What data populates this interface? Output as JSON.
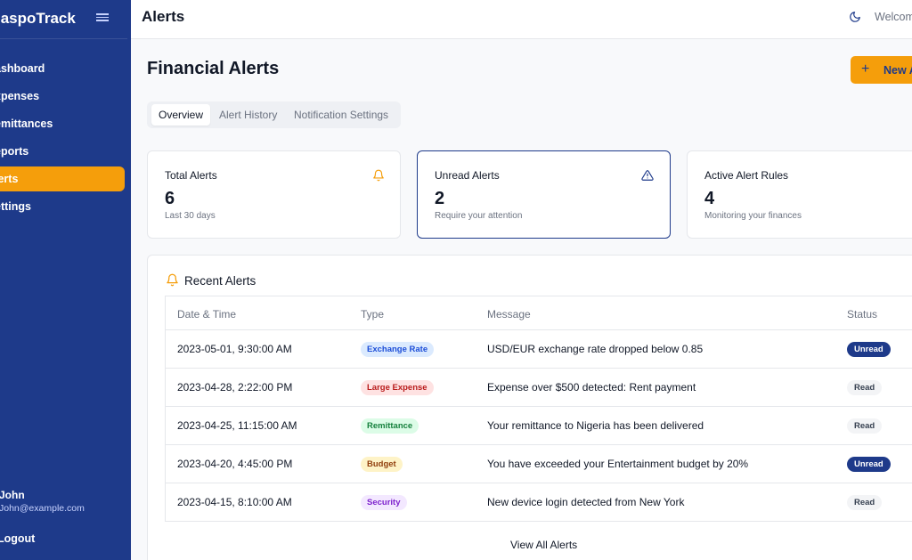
{
  "app": {
    "brand": "iaspoTrack"
  },
  "sidebar": {
    "items": [
      {
        "label": "ashboard",
        "active": false
      },
      {
        "label": "xpenses",
        "active": false
      },
      {
        "label": "emittances",
        "active": false
      },
      {
        "label": "eports",
        "active": false
      },
      {
        "label": "lerts",
        "active": true
      },
      {
        "label": "ettings",
        "active": false
      }
    ],
    "user": {
      "name": "John",
      "email": "John@example.com"
    },
    "logout_label": "Logout"
  },
  "topbar": {
    "title": "Alerts",
    "welcome": "Welcom"
  },
  "main": {
    "title": "Financial Alerts",
    "new_button_label": "New A",
    "tabs": [
      {
        "label": "Overview",
        "active": true
      },
      {
        "label": "Alert History",
        "active": false
      },
      {
        "label": "Notification Settings",
        "active": false
      }
    ],
    "cards": [
      {
        "title": "Total Alerts",
        "value": "6",
        "subtitle": "Last 30 days",
        "icon": "bell-icon"
      },
      {
        "title": "Unread Alerts",
        "value": "2",
        "subtitle": "Require your attention",
        "icon": "warning-triangle-icon"
      },
      {
        "title": "Active Alert Rules",
        "value": "4",
        "subtitle": "Monitoring your finances",
        "icon": ""
      }
    ],
    "recent": {
      "title": "Recent Alerts",
      "columns": [
        "Date & Time",
        "Type",
        "Message",
        "Status"
      ],
      "rows": [
        {
          "datetime": "2023-05-01, 9:30:00 AM",
          "type": "Exchange Rate",
          "message": "USD/EUR exchange rate dropped below 0.85",
          "status": "Unread"
        },
        {
          "datetime": "2023-04-28, 2:22:00 PM",
          "type": "Large Expense",
          "message": "Expense over $500 detected: Rent payment",
          "status": "Read"
        },
        {
          "datetime": "2023-04-25, 11:15:00 AM",
          "type": "Remittance",
          "message": "Your remittance to Nigeria has been delivered",
          "status": "Read"
        },
        {
          "datetime": "2023-04-20, 4:45:00 PM",
          "type": "Budget",
          "message": "You have exceeded your Entertainment budget by 20%",
          "status": "Unread"
        },
        {
          "datetime": "2023-04-15, 8:10:00 AM",
          "type": "Security",
          "message": "New device login detected from New York",
          "status": "Read"
        }
      ],
      "view_all_label": "View All Alerts"
    }
  },
  "colors": {
    "sidebar_bg": "#1e3a8a",
    "accent": "#f59e0b",
    "type_badges": {
      "Exchange Rate": {
        "bg": "#dbeafe",
        "fg": "#1d4ed8"
      },
      "Large Expense": {
        "bg": "#fee2e2",
        "fg": "#b91c1c"
      },
      "Remittance": {
        "bg": "#dcfce7",
        "fg": "#15803d"
      },
      "Budget": {
        "bg": "#fef3c7",
        "fg": "#92400e"
      },
      "Security": {
        "bg": "#f3e8ff",
        "fg": "#7e22ce"
      }
    }
  }
}
